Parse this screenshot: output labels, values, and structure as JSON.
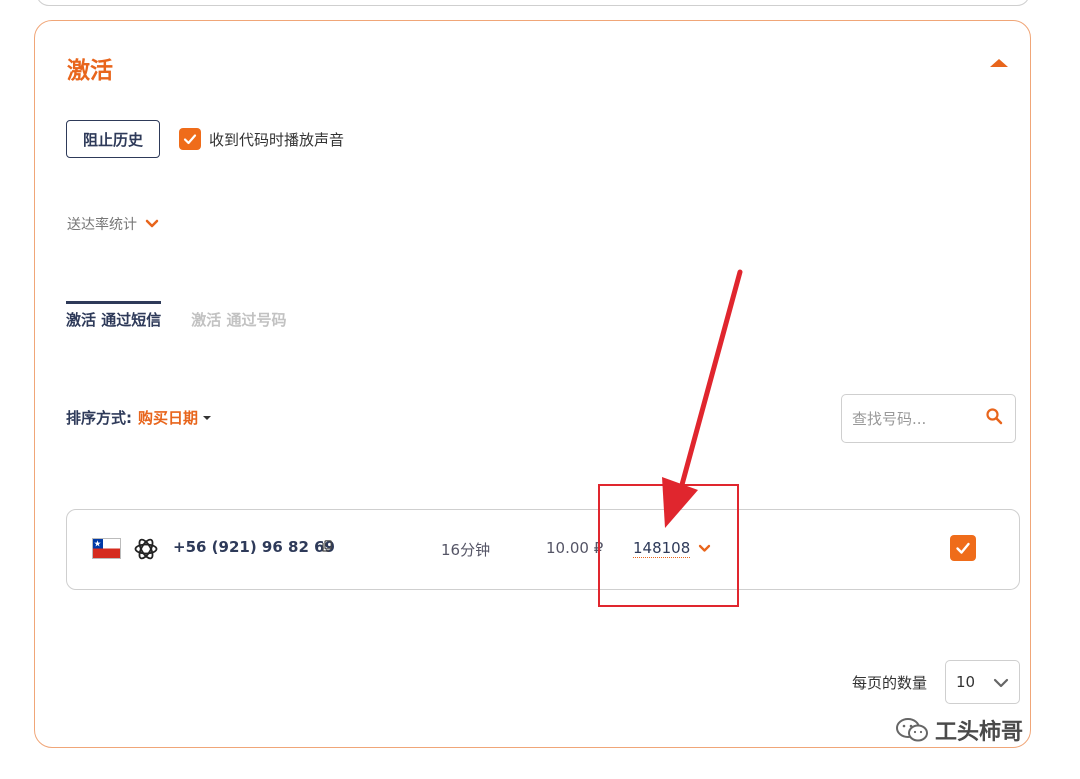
{
  "panel": {
    "title": "激活",
    "block_history_label": "阻止历史",
    "play_sound_label": "收到代码时播放声音",
    "play_sound_checked": true,
    "stats_label": "送达率统计"
  },
  "tabs": [
    {
      "label": "激活 通过短信",
      "active": true
    },
    {
      "label": "激活 通过号码",
      "active": false
    }
  ],
  "sort": {
    "label": "排序方式:",
    "value": "购买日期"
  },
  "search": {
    "placeholder": "查找号码..."
  },
  "numbers": [
    {
      "country_icon": "chile-flag-icon",
      "service_icon": "openai-icon",
      "phone": "+56 (921) 96 82 69",
      "duration": "16分钟",
      "price": "10.00 ₽",
      "code": "148108",
      "checked": true
    }
  ],
  "pagination": {
    "page_size_label": "每页的数量",
    "page_size_value": "10"
  },
  "watermark": {
    "text": "工头柿哥"
  },
  "colors": {
    "accent": "#e8651c",
    "navy": "#2e3a59",
    "annotation_red": "#e0262e"
  }
}
